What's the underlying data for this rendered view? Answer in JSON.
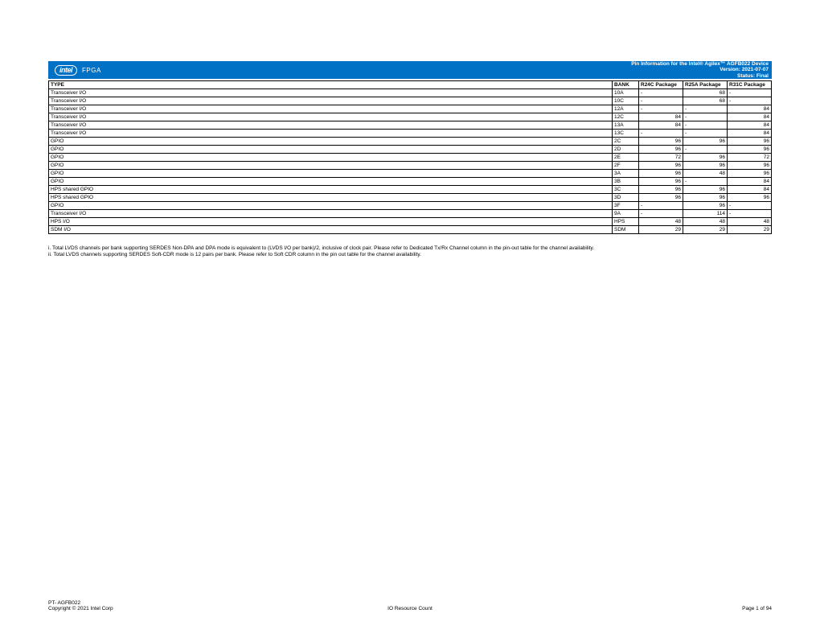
{
  "header": {
    "logo_brand": "intel",
    "logo_suffix": "FPGA",
    "title": "Pin Information for the Intel® Agilex™ AGFB022 Device",
    "version": "Version: 2021-07-07",
    "status": "Status: Final"
  },
  "table": {
    "columns": [
      "TYPE",
      "BANK",
      "R24C Package",
      "R25A Package",
      "R31C Package"
    ],
    "rows": [
      {
        "type": "Transceiver I/O",
        "bank": "10A",
        "r24c": "-",
        "r25a": "68",
        "r31c": "-"
      },
      {
        "type": "Transceiver I/O",
        "bank": "10C",
        "r24c": "-",
        "r25a": "68",
        "r31c": "-"
      },
      {
        "type": "Transceiver I/O",
        "bank": "12A",
        "r24c": "-",
        "r25a": "-",
        "r31c": "84"
      },
      {
        "type": "Transceiver I/O",
        "bank": "12C",
        "r24c": "84",
        "r25a": "-",
        "r31c": "84"
      },
      {
        "type": "Transceiver I/O",
        "bank": "13A",
        "r24c": "84",
        "r25a": "-",
        "r31c": "84"
      },
      {
        "type": "Transceiver I/O",
        "bank": "13C",
        "r24c": "-",
        "r25a": "-",
        "r31c": "84"
      },
      {
        "type": "GPIO",
        "bank": "2C",
        "r24c": "96",
        "r25a": "96",
        "r31c": "96"
      },
      {
        "type": "GPIO",
        "bank": "2D",
        "r24c": "96",
        "r25a": "-",
        "r31c": "96"
      },
      {
        "type": "GPIO",
        "bank": "2E",
        "r24c": "72",
        "r25a": "96",
        "r31c": "72"
      },
      {
        "type": "GPIO",
        "bank": "2F",
        "r24c": "96",
        "r25a": "96",
        "r31c": "96"
      },
      {
        "type": "GPIO",
        "bank": "3A",
        "r24c": "96",
        "r25a": "48",
        "r31c": "96"
      },
      {
        "type": "GPIO",
        "bank": "3B",
        "r24c": "96",
        "r25a": "-",
        "r31c": "84"
      },
      {
        "type": "HPS shared GPIO",
        "bank": "3C",
        "r24c": "96",
        "r25a": "96",
        "r31c": "84"
      },
      {
        "type": "HPS shared GPIO",
        "bank": "3D",
        "r24c": "96",
        "r25a": "96",
        "r31c": "96"
      },
      {
        "type": "GPIO",
        "bank": "3F",
        "r24c": "-",
        "r25a": "96",
        "r31c": "-"
      },
      {
        "type": "Transceiver I/O",
        "bank": "9A",
        "r24c": "-",
        "r25a": "114",
        "r31c": "-"
      },
      {
        "type": "HPS I/O",
        "bank": "HPS",
        "r24c": "48",
        "r25a": "48",
        "r31c": "48"
      },
      {
        "type": "SDM I/O",
        "bank": "SDM",
        "r24c": "29",
        "r25a": "29",
        "r31c": "29"
      }
    ]
  },
  "notes": {
    "n1": "i.  Total LVDS channels per bank supporting SERDES Non-DPA and DPA mode is equivalent to (LVDS I/O per bank)/2, inclusive of clock pair. Please refer to Dedicated Tx/Rx Channel column in the pin-out table for the channel availability.",
    "n2": "ii.  Total LVDS channels supporting SERDES Soft-CDR mode is 12 pairs per bank. Please refer to Soft CDR column in the pin out table for the channel availability."
  },
  "footer": {
    "pt": "PT- AGFB022",
    "copyright": "Copyright © 2021 Intel Corp",
    "center": "IO Resource Count",
    "page": "Page 1 of 94"
  }
}
